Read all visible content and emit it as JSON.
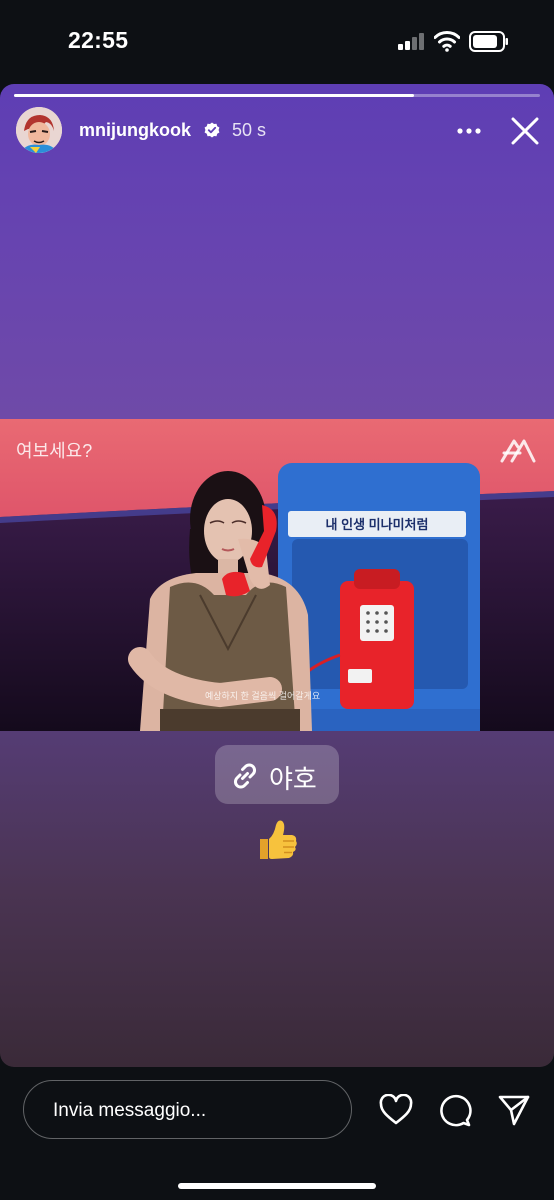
{
  "status_bar": {
    "time": "22:55"
  },
  "story": {
    "progress": 0.76,
    "username": "mnijungkook",
    "time_ago": "50 s",
    "media": {
      "caption": "여보세요?",
      "sign_text": "내 인생 미나미처럼",
      "subtitle": "예상하지 한 걸음씩 걸어갈게요"
    },
    "link_sticker": {
      "label": "야호"
    },
    "emoji": "thumbs-up"
  },
  "footer": {
    "message_placeholder": "Invia messaggio..."
  },
  "icons": {
    "avatar": "avatar",
    "verified": "verified-badge-icon",
    "more": "more-icon",
    "close": "close-icon",
    "link": "link-icon",
    "heart": "heart-icon",
    "comment": "comment-icon",
    "send": "send-icon"
  },
  "colors": {
    "background": "#0d1014",
    "story_top": "#5e3eb4",
    "story_bottom": "#3a2a38",
    "accent_red": "#e8232a",
    "booth_blue": "#2f6fd0"
  }
}
